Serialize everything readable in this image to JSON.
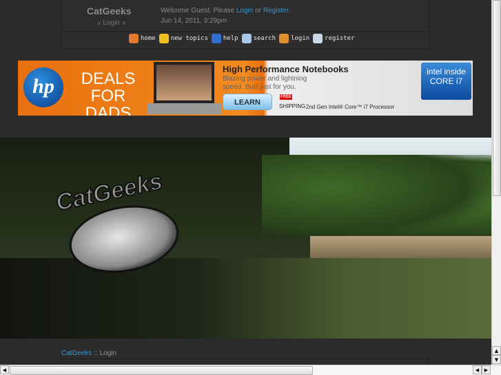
{
  "header": {
    "site_name": "CatGeeks",
    "sub_login": "« Login »",
    "welcome_prefix": "Welcome Guest. Please ",
    "login_link": "Login",
    "or": " or ",
    "register_link": "Register",
    "welcome_suffix": ".",
    "date": "Jun 14, 2011, 3:29pm"
  },
  "nav": [
    {
      "label": "home",
      "icon": "house-icon",
      "color": "#e07a30"
    },
    {
      "label": "new topics",
      "icon": "star-icon",
      "color": "#f0c020"
    },
    {
      "label": "help",
      "icon": "help-icon",
      "color": "#2f6fd0"
    },
    {
      "label": "search",
      "icon": "search-icon",
      "color": "#a8c8e8"
    },
    {
      "label": "login",
      "icon": "login-icon",
      "color": "#e09030"
    },
    {
      "label": "register",
      "icon": "register-icon",
      "color": "#c8d8e8"
    }
  ],
  "ad": {
    "brand": "hp",
    "headline": "DEALS FOR DADS",
    "title": "High Performance Notebooks",
    "subtitle": "Blazing power and lightning speed. Built just for you.",
    "cta": "LEARN MORE »",
    "free": "FREE",
    "shipping": "SHIPPING",
    "processor": "2nd Gen Intel® Core™ i7 Processor",
    "intel_badge": "intel inside CORE i7"
  },
  "hero": {
    "logo_text": "CatGeeks"
  },
  "breadcrumb": {
    "link": "CatGeeks",
    "sep": " :: ",
    "current": "Login"
  }
}
